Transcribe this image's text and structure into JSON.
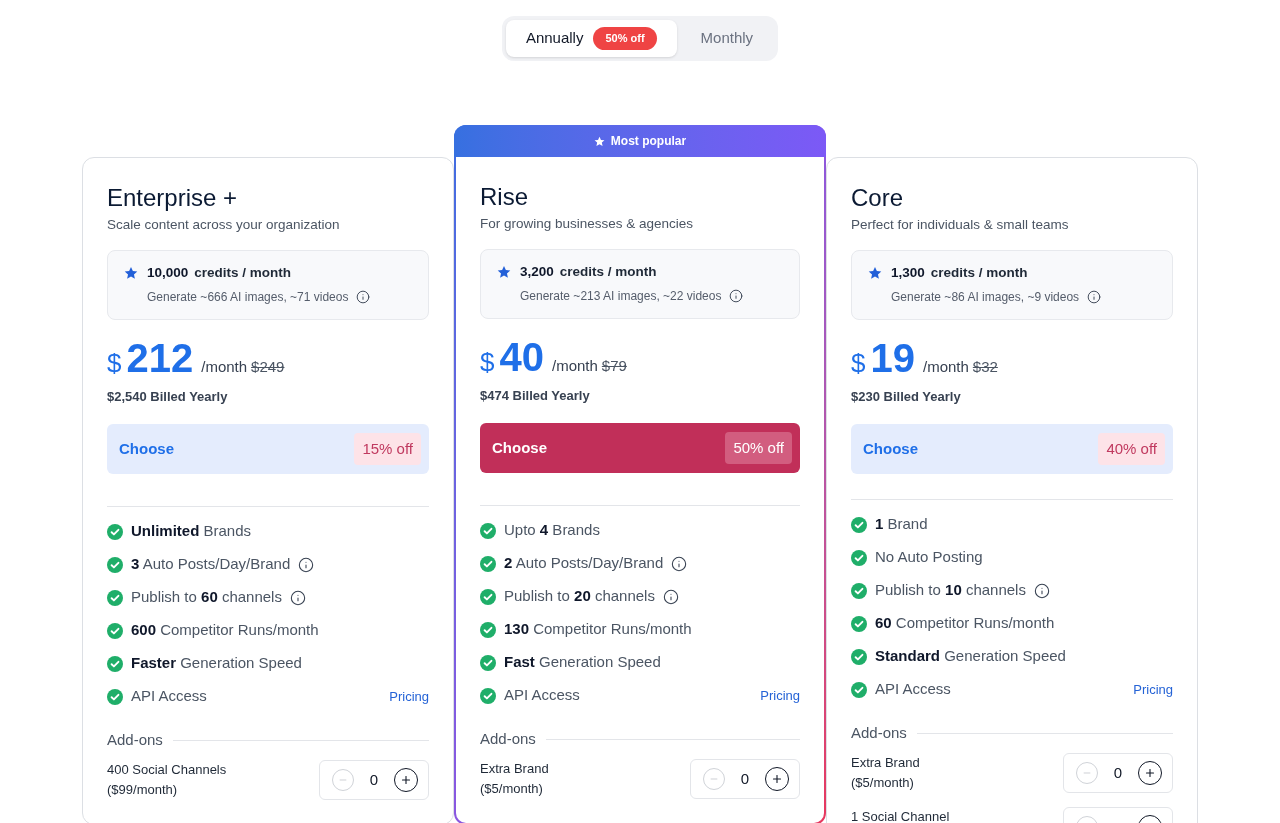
{
  "billing_toggle": {
    "options": [
      {
        "label": "Annually",
        "badge": "50% off",
        "selected": true
      },
      {
        "label": "Monthly",
        "selected": false
      }
    ]
  },
  "plans": [
    {
      "name": "Enterprise +",
      "tagline": "Scale content across your organization",
      "popular": false,
      "credits": {
        "amount": "10,000",
        "unit": "credits / month",
        "detail": "Generate ~666 AI images, ~71 videos"
      },
      "price": {
        "currency": "$",
        "amount": "212",
        "period": "/month",
        "original": "$249"
      },
      "billed": "$2,540 Billed Yearly",
      "cta": {
        "label": "Choose",
        "discount": "15% off"
      },
      "features": [
        {
          "text": "**Unlimited** Brands"
        },
        {
          "text": "**3** Auto Posts/Day/Brand",
          "info": true
        },
        {
          "text": "Publish to **60** channels",
          "info": true
        },
        {
          "text": "**600** Competitor Runs/month"
        },
        {
          "text": "**Faster** Generation Speed"
        },
        {
          "text": "API Access",
          "link": "Pricing"
        }
      ],
      "addons_heading": "Add-ons",
      "addons": [
        {
          "name": "400 Social Channels",
          "price": "($99/month)",
          "quantity": "0"
        }
      ]
    },
    {
      "badge": "Most popular",
      "name": "Rise",
      "tagline": "For growing businesses & agencies",
      "popular": true,
      "credits": {
        "amount": "3,200",
        "unit": "credits / month",
        "detail": "Generate ~213 AI images, ~22 videos"
      },
      "price": {
        "currency": "$",
        "amount": "40",
        "period": "/month",
        "original": "$79"
      },
      "billed": "$474 Billed Yearly",
      "cta": {
        "label": "Choose",
        "discount": "50% off"
      },
      "features": [
        {
          "text": "Upto **4** Brands"
        },
        {
          "text": "**2** Auto Posts/Day/Brand",
          "info": true
        },
        {
          "text": "Publish to **20** channels",
          "info": true
        },
        {
          "text": "**130** Competitor Runs/month"
        },
        {
          "text": "**Fast** Generation Speed"
        },
        {
          "text": "API Access",
          "link": "Pricing"
        }
      ],
      "addons_heading": "Add-ons",
      "addons": [
        {
          "name": "Extra Brand",
          "price": "($5/month)",
          "quantity": "0"
        }
      ]
    },
    {
      "name": "Core",
      "tagline": "Perfect for individuals & small teams",
      "popular": false,
      "credits": {
        "amount": "1,300",
        "unit": "credits / month",
        "detail": "Generate ~86 AI images, ~9 videos"
      },
      "price": {
        "currency": "$",
        "amount": "19",
        "period": "/month",
        "original": "$32"
      },
      "billed": "$230 Billed Yearly",
      "cta": {
        "label": "Choose",
        "discount": "40% off"
      },
      "features": [
        {
          "text": "**1** Brand"
        },
        {
          "text": "No Auto Posting"
        },
        {
          "text": "Publish to **10** channels",
          "info": true
        },
        {
          "text": "**60** Competitor Runs/month"
        },
        {
          "text": "**Standard** Generation Speed"
        },
        {
          "text": "API Access",
          "link": "Pricing"
        }
      ],
      "addons_heading": "Add-ons",
      "addons": [
        {
          "name": "Extra Brand",
          "price": "($5/month)",
          "quantity": "0"
        },
        {
          "name": "1 Social Channel"
        }
      ]
    }
  ]
}
